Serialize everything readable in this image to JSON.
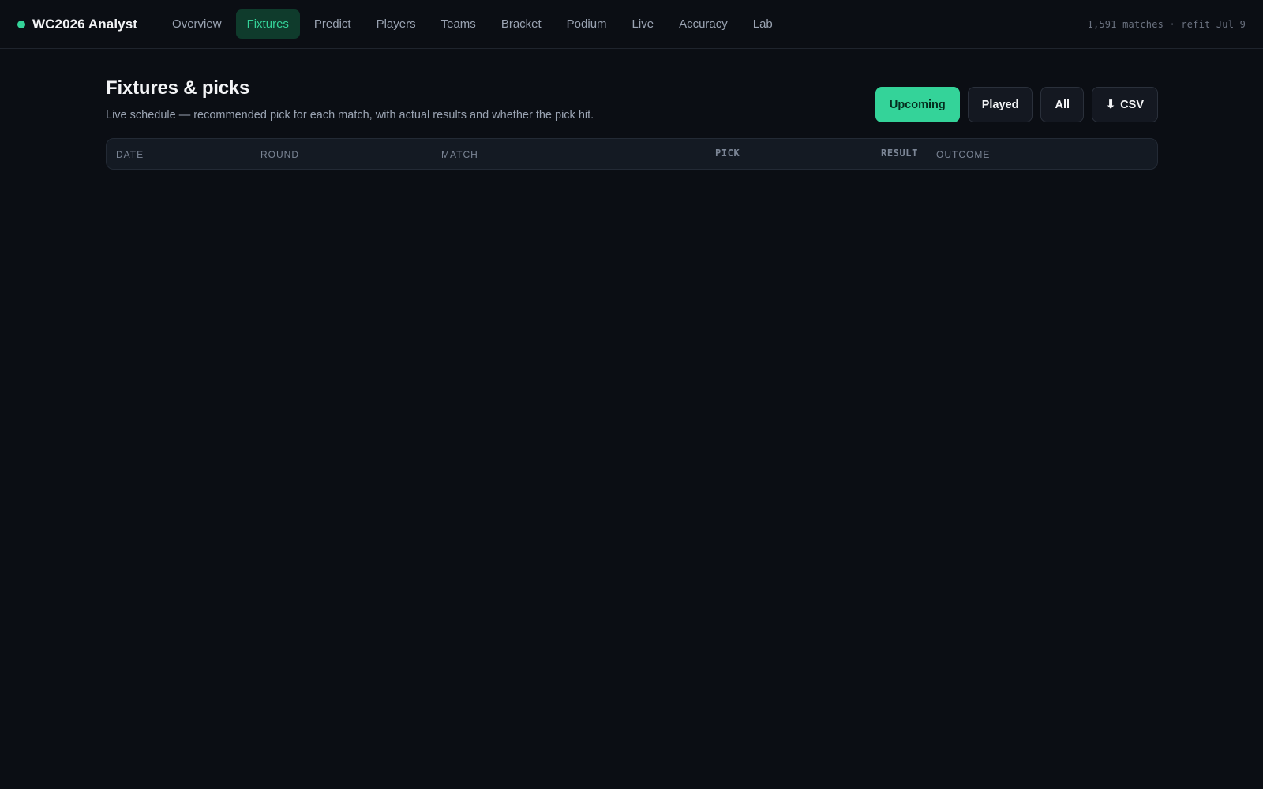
{
  "app": {
    "title": "WC2026 Analyst",
    "accent": "#34d399"
  },
  "nav": {
    "items": [
      {
        "label": "Overview",
        "active": false
      },
      {
        "label": "Fixtures",
        "active": true
      },
      {
        "label": "Predict",
        "active": false
      },
      {
        "label": "Players",
        "active": false
      },
      {
        "label": "Teams",
        "active": false
      },
      {
        "label": "Bracket",
        "active": false
      },
      {
        "label": "Podium",
        "active": false
      },
      {
        "label": "Live",
        "active": false
      },
      {
        "label": "Accuracy",
        "active": false
      },
      {
        "label": "Lab",
        "active": false
      }
    ]
  },
  "status": {
    "meta": "1,591 matches · refit Jul 9"
  },
  "page": {
    "title": "Fixtures & picks",
    "subtitle": "Live schedule — recommended pick for each match, with actual results and whether the pick hit."
  },
  "filters": {
    "upcoming": "Upcoming",
    "played": "Played",
    "all": "All",
    "csv_icon": "download-icon",
    "csv_glyph": "⬇",
    "csv": "CSV",
    "selected": "Upcoming"
  },
  "table": {
    "columns": {
      "date": "Date",
      "round": "Round",
      "match": "Match",
      "pick": "Pick",
      "result": "Result",
      "outcome": "Outcome"
    },
    "rows": []
  }
}
